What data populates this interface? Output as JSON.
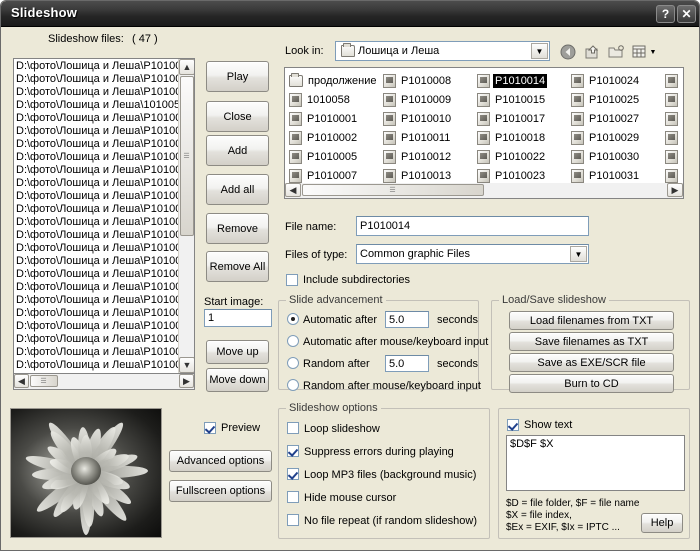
{
  "window": {
    "title": "Slideshow",
    "help_caption": "?",
    "close_caption": "✕"
  },
  "left_panel": {
    "list_label": "Slideshow files:",
    "list_count": "( 47 )",
    "file_entries": [
      "D:\\фото\\Лошица и Леша\\P10100",
      "D:\\фото\\Лошица и Леша\\P10100",
      "D:\\фото\\Лошица и Леша\\P10100",
      "D:\\фото\\Лошица и Леша\\101005",
      "D:\\фото\\Лошица и Леша\\P10100",
      "D:\\фото\\Лошица и Леша\\P10100",
      "D:\\фото\\Лошица и Леша\\P10100",
      "D:\\фото\\Лошица и Леша\\P10100",
      "D:\\фото\\Лошица и Леша\\P10100",
      "D:\\фото\\Лошица и Леша\\P10100",
      "D:\\фото\\Лошица и Леша\\P10100",
      "D:\\фото\\Лошица и Леша\\P10100",
      "D:\\фото\\Лошица и Леша\\P10100",
      "D:\\фото\\Лошица и Леша\\P10100",
      "D:\\фото\\Лошица и Леша\\P10100",
      "D:\\фото\\Лошица и Леша\\P10100",
      "D:\\фото\\Лошица и Леша\\P10100",
      "D:\\фото\\Лошица и Леша\\P10100",
      "D:\\фото\\Лошица и Леша\\P10100",
      "D:\\фото\\Лошица и Леша\\P10100",
      "D:\\фото\\Лошица и Леша\\P10100",
      "D:\\фото\\Лошица и Леша\\P10100",
      "D:\\фото\\Лошица и Леша\\P10100",
      "D:\\фото\\Лошица и Леша\\P10100"
    ]
  },
  "action_buttons": [
    {
      "id": "play",
      "label": "Play"
    },
    {
      "id": "close",
      "label": "Close"
    },
    {
      "id": "add",
      "label": "Add"
    },
    {
      "id": "add-all",
      "label": "Add all"
    },
    {
      "id": "remove",
      "label": "Remove"
    },
    {
      "id": "remove-all",
      "label": "Remove All"
    }
  ],
  "start_image": {
    "label": "Start image:",
    "value": "1"
  },
  "move_buttons": [
    {
      "id": "move-up",
      "label": "Move up"
    },
    {
      "id": "move-down",
      "label": "Move down"
    }
  ],
  "browser": {
    "lookin_label": "Look in:",
    "lookin_value": "Лошица и Леша",
    "toolbar_icons": [
      "back-icon",
      "up-folder-icon",
      "new-folder-icon",
      "views-icon"
    ],
    "columns": [
      {
        "items": [
          {
            "name": "продолжение",
            "type": "folder",
            "selected": false
          },
          {
            "name": "1010058",
            "type": "file",
            "selected": false
          },
          {
            "name": "P1010001",
            "type": "file",
            "selected": false
          },
          {
            "name": "P1010002",
            "type": "file",
            "selected": false
          },
          {
            "name": "P1010005",
            "type": "file",
            "selected": false
          },
          {
            "name": "P1010007",
            "type": "file",
            "selected": false
          }
        ]
      },
      {
        "items": [
          {
            "name": "P1010008",
            "type": "file",
            "selected": false
          },
          {
            "name": "P1010009",
            "type": "file",
            "selected": false
          },
          {
            "name": "P1010010",
            "type": "file",
            "selected": false
          },
          {
            "name": "P1010011",
            "type": "file",
            "selected": false
          },
          {
            "name": "P1010012",
            "type": "file",
            "selected": false
          },
          {
            "name": "P1010013",
            "type": "file",
            "selected": false
          }
        ]
      },
      {
        "items": [
          {
            "name": "P1010014",
            "type": "file",
            "selected": true
          },
          {
            "name": "P1010015",
            "type": "file",
            "selected": false
          },
          {
            "name": "P1010017",
            "type": "file",
            "selected": false
          },
          {
            "name": "P1010018",
            "type": "file",
            "selected": false
          },
          {
            "name": "P1010022",
            "type": "file",
            "selected": false
          },
          {
            "name": "P1010023",
            "type": "file",
            "selected": false
          }
        ]
      },
      {
        "items": [
          {
            "name": "P1010024",
            "type": "file",
            "selected": false
          },
          {
            "name": "P1010025",
            "type": "file",
            "selected": false
          },
          {
            "name": "P1010027",
            "type": "file",
            "selected": false
          },
          {
            "name": "P1010029",
            "type": "file",
            "selected": false
          },
          {
            "name": "P1010030",
            "type": "file",
            "selected": false
          },
          {
            "name": "P1010031",
            "type": "file",
            "selected": false
          }
        ]
      },
      {
        "items": [
          {
            "name": "",
            "type": "file",
            "selected": false
          },
          {
            "name": "",
            "type": "file",
            "selected": false
          },
          {
            "name": "",
            "type": "file",
            "selected": false
          },
          {
            "name": "",
            "type": "file",
            "selected": false
          },
          {
            "name": "",
            "type": "file",
            "selected": false
          },
          {
            "name": "",
            "type": "file",
            "selected": false
          }
        ]
      }
    ],
    "filename_label": "File name:",
    "filename_value": "P1010014",
    "filetype_label": "Files of type:",
    "filetype_value": "Common graphic Files",
    "include_subdirs_label": "Include subdirectories",
    "include_subdirs_checked": false
  },
  "slide_advancement": {
    "title": "Slide advancement",
    "options": [
      {
        "id": "automatic-after-seconds",
        "label_before": "Automatic  after",
        "value": "5.0",
        "label_after": "seconds",
        "has_input": true,
        "selected": true
      },
      {
        "id": "automatic-after-input",
        "label_before": "Automatic  after mouse/keyboard input",
        "has_input": false,
        "selected": false
      },
      {
        "id": "random-after-seconds",
        "label_before": "Random    after",
        "value": "5.0",
        "label_after": "seconds",
        "has_input": true,
        "selected": false
      },
      {
        "id": "random-after-input",
        "label_before": "Random   after mouse/keyboard input",
        "has_input": false,
        "selected": false
      }
    ]
  },
  "load_save": {
    "title": "Load/Save slideshow",
    "buttons": [
      {
        "id": "load-filenames-txt",
        "label": "Load filenames from TXT"
      },
      {
        "id": "save-filenames-txt",
        "label": "Save filenames as TXT"
      },
      {
        "id": "save-exe-scr",
        "label": "Save as  EXE/SCR file"
      },
      {
        "id": "burn-to-cd",
        "label": "Burn to CD"
      }
    ]
  },
  "slideshow_options": {
    "title": "Slideshow options",
    "items": [
      {
        "id": "loop-slideshow",
        "label": "Loop slideshow",
        "checked": false
      },
      {
        "id": "suppress-errors",
        "label": "Suppress errors during playing",
        "checked": true
      },
      {
        "id": "loop-mp3",
        "label": "Loop MP3 files (background music)",
        "checked": true
      },
      {
        "id": "hide-cursor",
        "label": "Hide mouse cursor",
        "checked": false
      },
      {
        "id": "no-file-repeat",
        "label": "No file repeat (if random slideshow)",
        "checked": false
      }
    ]
  },
  "preview_panel": {
    "preview_label": "Preview",
    "preview_checked": true,
    "advanced_label": "Advanced options",
    "fullscreen_label": "Fullscreen options"
  },
  "show_text": {
    "label": "Show text",
    "checked": true,
    "value": "$D$F $X",
    "hint_line1": "$D = file folder, $F = file name",
    "hint_line2": "$X = file index,",
    "hint_line3": "$Ex = EXIF, $Ix = IPTC ...",
    "help_label": "Help"
  },
  "colors": {
    "dialog_face": "#ece9d8",
    "titlebar_dark": "#1a1a1a",
    "selection": "#000000",
    "field_border": "#7f9db9"
  }
}
